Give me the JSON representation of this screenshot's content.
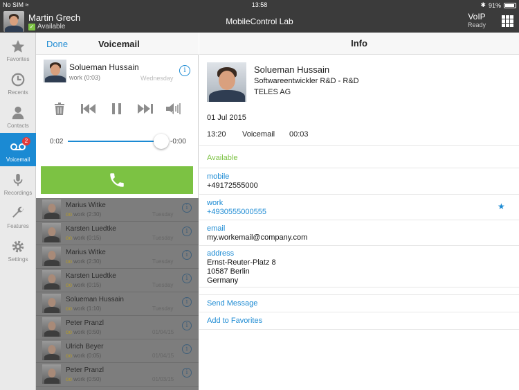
{
  "status_bar": {
    "carrier": "No SIM",
    "time": "13:58",
    "battery": "91%"
  },
  "header": {
    "user_name": "Martin Grech",
    "user_status": "Available",
    "app_title": "MobileControl Lab",
    "line_name": "VoIP",
    "line_status": "Ready"
  },
  "sidebar": {
    "items": [
      {
        "label": "Favorites",
        "icon": "star-icon"
      },
      {
        "label": "Recents",
        "icon": "clock-icon"
      },
      {
        "label": "Contacts",
        "icon": "person-icon"
      },
      {
        "label": "Voicemail",
        "icon": "voicemail-icon",
        "badge": "2"
      },
      {
        "label": "Recordings",
        "icon": "microphone-icon"
      },
      {
        "label": "Features",
        "icon": "wrench-icon"
      },
      {
        "label": "Settings",
        "icon": "gear-icon"
      }
    ]
  },
  "voicemail_panel": {
    "done_label": "Done",
    "title": "Voicemail",
    "current": {
      "name": "Solueman Hussain",
      "sub": "work (0:03)",
      "day": "Wednesday"
    },
    "elapsed": "0:02",
    "remaining": "-0:00",
    "progress": 0.95,
    "list": [
      {
        "name": "Marius Witke",
        "sub": "work (2:30)",
        "date": "Tuesday"
      },
      {
        "name": "Karsten Luedtke",
        "sub": "work (0:15)",
        "date": "Tuesday"
      },
      {
        "name": "Marius Witke",
        "sub": "work (2:30)",
        "date": "Tuesday"
      },
      {
        "name": "Karsten Luedtke",
        "sub": "work (0:15)",
        "date": "Tuesday"
      },
      {
        "name": "Solueman Hussain",
        "sub": "work (1:10)",
        "date": "Tuesday"
      },
      {
        "name": "Peter Pranzl",
        "sub": "work (0:50)",
        "date": "01/04/15"
      },
      {
        "name": "Ulrich Beyer",
        "sub": "work (0:05)",
        "date": "01/04/15"
      },
      {
        "name": "Peter Pranzl",
        "sub": "work (0:50)",
        "date": "01/03/15"
      }
    ]
  },
  "info_panel": {
    "title": "Info",
    "name": "Solueman Hussain",
    "job": "Softwareentwickler R&D - R&D",
    "company": "TELES AG",
    "date": "01 Jul 2015",
    "time": "13:20",
    "type": "Voicemail",
    "duration": "00:03",
    "availability": "Available",
    "fields": [
      {
        "label": "mobile",
        "value": "+49172555000"
      },
      {
        "label": "work",
        "value": "+4930555000555"
      },
      {
        "label": "email",
        "value": "my.workemail@company.com"
      },
      {
        "label": "address",
        "value": "Ernst-Reuter-Platz 8",
        "value2": "10587 Berlin",
        "value3": "Germany"
      }
    ],
    "send_message": "Send Message",
    "add_favorites": "Add to Favorites"
  },
  "colors": {
    "accent": "#1b8ad3",
    "call_green": "#7cc243",
    "header": "#3b3b3b"
  }
}
